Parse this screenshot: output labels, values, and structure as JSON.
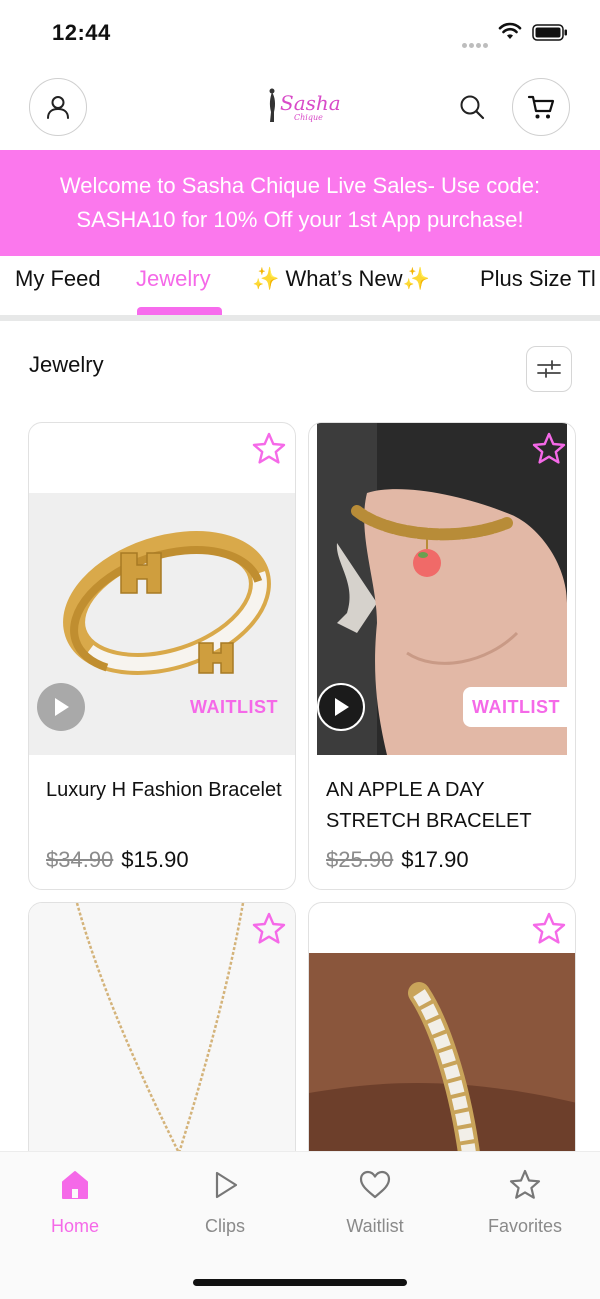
{
  "status_bar": {
    "time": "12:44"
  },
  "header": {
    "logo_text": "Sasha",
    "logo_subtext": "Chique"
  },
  "promo": {
    "line1": "Welcome to Sasha Chique Live Sales- Use code:",
    "line2": "SASHA10 for 10% Off your 1st App purchase!"
  },
  "tabs": [
    {
      "label": "My Feed",
      "active": false
    },
    {
      "label": "Jewelry",
      "active": true
    },
    {
      "label": "✨ What’s New✨",
      "active": false
    },
    {
      "label": "Plus Size Tl",
      "active": false
    }
  ],
  "section": {
    "title": "Jewelry"
  },
  "products": [
    {
      "name": "Luxury H Fashion Bracelet",
      "price_old": "$34.90",
      "price_new": "$15.90",
      "badge": "WAITLIST",
      "icon": "star-icon"
    },
    {
      "name": "AN APPLE A DAY STRETCH BRACELET",
      "price_old": "$25.90",
      "price_new": "$17.90",
      "badge": "WAITLIST",
      "icon": "star-icon"
    },
    {
      "name": "",
      "price_old": "",
      "price_new": "",
      "badge": "",
      "icon": "star-icon"
    },
    {
      "name": "",
      "price_old": "",
      "price_new": "",
      "badge": "",
      "icon": "star-icon"
    }
  ],
  "bottom_nav": [
    {
      "label": "Home",
      "icon": "home-icon",
      "active": true
    },
    {
      "label": "Clips",
      "icon": "play-icon",
      "active": false
    },
    {
      "label": "Waitlist",
      "icon": "heart-icon",
      "active": false
    },
    {
      "label": "Favorites",
      "icon": "star-icon",
      "active": false
    }
  ],
  "colors": {
    "accent": "#f569e8",
    "banner": "#fb78ed",
    "muted": "#8a8a8a"
  }
}
